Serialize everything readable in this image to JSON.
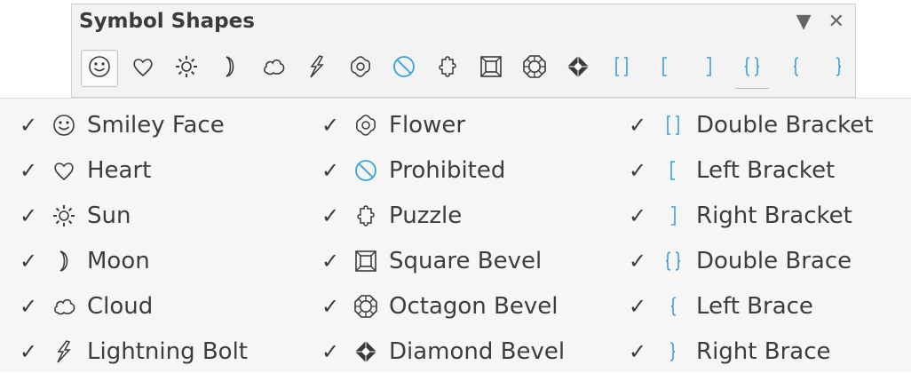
{
  "toolbar": {
    "title": "Symbol Shapes",
    "dropdown_glyph": "▼",
    "close_glyph": "✕",
    "icons": [
      "smiley-face-icon",
      "heart-icon",
      "sun-icon",
      "moon-icon",
      "cloud-icon",
      "lightning-bolt-icon",
      "flower-icon",
      "prohibited-icon",
      "puzzle-icon",
      "square-bevel-icon",
      "octagon-bevel-icon",
      "diamond-bevel-icon",
      "double-bracket-icon",
      "left-bracket-icon",
      "right-bracket-icon",
      "double-brace-icon",
      "left-brace-icon",
      "right-brace-icon"
    ],
    "active_icon": "smiley-face-icon"
  },
  "menu": {
    "check_glyph": "✓",
    "items": [
      {
        "label": "Smiley Face",
        "icon": "smiley-face-icon"
      },
      {
        "label": "Heart",
        "icon": "heart-icon"
      },
      {
        "label": "Sun",
        "icon": "sun-icon"
      },
      {
        "label": "Moon",
        "icon": "moon-icon"
      },
      {
        "label": "Cloud",
        "icon": "cloud-icon"
      },
      {
        "label": "Lightning Bolt",
        "icon": "lightning-bolt-icon"
      },
      {
        "label": "Flower",
        "icon": "flower-icon"
      },
      {
        "label": "Prohibited",
        "icon": "prohibited-icon"
      },
      {
        "label": "Puzzle",
        "icon": "puzzle-icon"
      },
      {
        "label": "Square Bevel",
        "icon": "square-bevel-icon"
      },
      {
        "label": "Octagon Bevel",
        "icon": "octagon-bevel-icon"
      },
      {
        "label": "Diamond Bevel",
        "icon": "diamond-bevel-icon"
      },
      {
        "label": "Double Bracket",
        "icon": "double-bracket-icon"
      },
      {
        "label": "Left Bracket",
        "icon": "left-bracket-icon"
      },
      {
        "label": "Right Bracket",
        "icon": "right-bracket-icon"
      },
      {
        "label": "Double Brace",
        "icon": "double-brace-icon"
      },
      {
        "label": "Left Brace",
        "icon": "left-brace-icon"
      },
      {
        "label": "Right Brace",
        "icon": "right-brace-icon"
      }
    ]
  },
  "colors": {
    "icon_stroke": "#3a3a3a",
    "accent_blue": "#3aa0d8",
    "panel_bg": "#f3f3f3",
    "menu_bg": "#f6f6f6"
  }
}
